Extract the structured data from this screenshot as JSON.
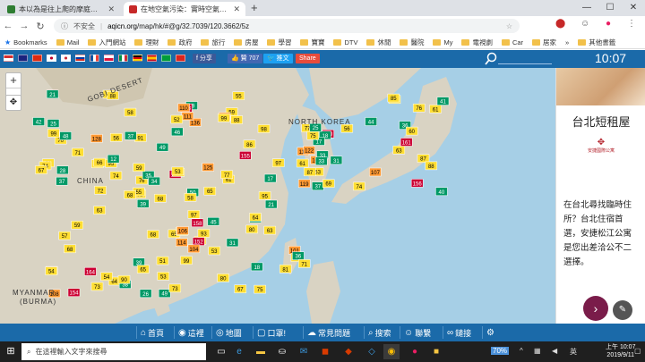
{
  "browser": {
    "tabs": [
      {
        "title": "本以為是往上爬的摩庭，卻走向",
        "favicon_color": "#2e7d32",
        "active": false
      },
      {
        "title": "在地空氣污染：實時空氣質量指數",
        "favicon_color": "#c62828",
        "active": true
      }
    ],
    "new_tab": "+",
    "window": {
      "minimize": "—",
      "maximize": "☐",
      "close": "✕"
    },
    "nav": {
      "back": "←",
      "forward": "→",
      "reload": "C"
    },
    "address": {
      "security": "不安全",
      "host": "aqicn.org",
      "path": "/map/hk/#@g/32.7039/120.3662/5z"
    },
    "bookmarks": [
      {
        "label": "Bookmarks",
        "type": "star"
      },
      {
        "label": "Mail",
        "type": "folder"
      },
      {
        "label": "入門網站",
        "type": "folder"
      },
      {
        "label": "理財",
        "type": "folder"
      },
      {
        "label": "政府",
        "type": "folder"
      },
      {
        "label": "旅行",
        "type": "folder"
      },
      {
        "label": "房屋",
        "type": "folder"
      },
      {
        "label": "學習",
        "type": "folder"
      },
      {
        "label": "寶寶",
        "type": "folder"
      },
      {
        "label": "DTV",
        "type": "folder"
      },
      {
        "label": "休閒",
        "type": "folder"
      },
      {
        "label": "醫院",
        "type": "folder"
      },
      {
        "label": "My",
        "type": "folder"
      },
      {
        "label": "電視劇",
        "type": "folder"
      },
      {
        "label": "Car",
        "type": "folder"
      },
      {
        "label": "居家",
        "type": "folder"
      },
      {
        "label": "»",
        "type": "more"
      },
      {
        "label": "其他書籤",
        "type": "folder"
      }
    ]
  },
  "site": {
    "share": {
      "fb_share": "f 分享",
      "like": "👍 贊 707",
      "tweet": "🐦 推文",
      "share": "Share"
    },
    "clock": "10:07",
    "map_labels": {
      "china": "CHINA",
      "north_korea": "NORTH KOREA",
      "myanmar": "MYANMAR",
      "burma": "(BURMA)",
      "gobi": "GOBI DESERT"
    },
    "zoom": {
      "in": "+",
      "out": "−"
    },
    "footer": [
      {
        "icon": "home-icon",
        "glyph": "⌂",
        "label": "首頁"
      },
      {
        "icon": "eye-icon",
        "glyph": "◉",
        "label": "這裡"
      },
      {
        "icon": "globe-icon",
        "glyph": "◎",
        "label": "地圖"
      },
      {
        "icon": "mask-icon",
        "glyph": "▢",
        "label": "口罩!"
      },
      {
        "icon": "faq-icon",
        "glyph": "☁",
        "label": "常見問題"
      },
      {
        "icon": "search-icon",
        "glyph": "⌕",
        "label": "搜索"
      },
      {
        "icon": "contact-icon",
        "glyph": "☺",
        "label": "聯繫"
      },
      {
        "icon": "link-icon",
        "glyph": "∞",
        "label": "鏈接"
      },
      {
        "icon": "settings-icon",
        "glyph": "⚙",
        "label": ""
      }
    ]
  },
  "ad": {
    "title": "台北短租屋",
    "logo_text": "安捷國際公寓",
    "body": "在台北尋找臨時住所？台北住宿首選，安捷松江公寓是您出差洽公不二選擇。",
    "next": "›"
  },
  "taskbar": {
    "search_placeholder": "在這裡輸入文字來搜尋",
    "battery": "70%",
    "ime": "英",
    "time": "上午 10:07",
    "date": "2019/9/11"
  },
  "colors": {
    "site_blue": "#1b6aa9",
    "good": "#009966",
    "moderate": "#ffde33",
    "sensitive": "#ff9933",
    "unhealthy": "#cc0033",
    "very_unhealthy": "#660099"
  },
  "markers": [
    {
      "v": "63",
      "c": "moderate"
    },
    {
      "v": "70",
      "c": "moderate"
    },
    {
      "v": "92",
      "c": "moderate"
    },
    {
      "v": "112",
      "c": "sensitive"
    },
    {
      "v": "151",
      "c": "unhealthy"
    },
    {
      "v": "84",
      "c": "moderate"
    },
    {
      "v": "49",
      "c": "good"
    },
    {
      "v": "57",
      "c": "moderate"
    },
    {
      "v": "136",
      "c": "sensitive"
    },
    {
      "v": "161",
      "c": "unhealthy"
    },
    {
      "v": "111",
      "c": "sensitive"
    },
    {
      "v": "75",
      "c": "moderate"
    },
    {
      "v": "37",
      "c": "good"
    },
    {
      "v": "98",
      "c": "moderate"
    },
    {
      "v": "102",
      "c": "sensitive"
    },
    {
      "v": "155",
      "c": "unhealthy"
    },
    {
      "v": "154",
      "c": "unhealthy"
    },
    {
      "v": "91",
      "c": "moderate"
    },
    {
      "v": "36",
      "c": "good"
    },
    {
      "v": "68",
      "c": "moderate"
    },
    {
      "v": "125",
      "c": "sensitive"
    },
    {
      "v": "119",
      "c": "sensitive"
    },
    {
      "v": "164",
      "c": "unhealthy"
    },
    {
      "v": "101",
      "c": "sensitive"
    },
    {
      "v": "82",
      "c": "moderate"
    },
    {
      "v": "25",
      "c": "good"
    },
    {
      "v": "48",
      "c": "good"
    },
    {
      "v": "62",
      "c": "moderate"
    },
    {
      "v": "117",
      "c": "sensitive"
    },
    {
      "v": "158",
      "c": "unhealthy"
    },
    {
      "v": "97",
      "c": "moderate"
    },
    {
      "v": "55",
      "c": "moderate"
    },
    {
      "v": "39",
      "c": "good"
    },
    {
      "v": "76",
      "c": "moderate"
    },
    {
      "v": "128",
      "c": "sensitive"
    },
    {
      "v": "160",
      "c": "unhealthy"
    },
    {
      "v": "107",
      "c": "sensitive"
    },
    {
      "v": "67",
      "c": "moderate"
    },
    {
      "v": "18",
      "c": "good"
    },
    {
      "v": "45",
      "c": "good"
    },
    {
      "v": "59",
      "c": "moderate"
    },
    {
      "v": "95",
      "c": "moderate"
    },
    {
      "v": "122",
      "c": "sensitive"
    },
    {
      "v": "152",
      "c": "unhealthy"
    },
    {
      "v": "73",
      "c": "moderate"
    },
    {
      "v": "56",
      "c": "moderate"
    },
    {
      "v": "79",
      "c": "moderate"
    },
    {
      "v": "108",
      "c": "sensitive"
    },
    {
      "v": "65",
      "c": "moderate"
    },
    {
      "v": "33",
      "c": "good"
    },
    {
      "v": "114",
      "c": "sensitive"
    },
    {
      "v": "86",
      "c": "moderate"
    },
    {
      "v": "42",
      "c": "good"
    },
    {
      "v": "93",
      "c": "moderate"
    },
    {
      "v": "156",
      "c": "unhealthy"
    },
    {
      "v": "104",
      "c": "sensitive"
    },
    {
      "v": "77",
      "c": "moderate"
    },
    {
      "v": "21",
      "c": "good"
    },
    {
      "v": "51",
      "c": "moderate"
    },
    {
      "v": "88",
      "c": "moderate"
    },
    {
      "v": "131",
      "c": "sensitive"
    },
    {
      "v": "72",
      "c": "moderate"
    },
    {
      "v": "61",
      "c": "moderate"
    },
    {
      "v": "44",
      "c": "good"
    },
    {
      "v": "99",
      "c": "moderate"
    },
    {
      "v": "153",
      "c": "unhealthy"
    },
    {
      "v": "110",
      "c": "sensitive"
    },
    {
      "v": "58",
      "c": "moderate"
    },
    {
      "v": "35",
      "c": "good"
    },
    {
      "v": "81",
      "c": "moderate"
    },
    {
      "v": "53",
      "c": "moderate"
    },
    {
      "v": "64",
      "c": "moderate"
    },
    {
      "v": "87",
      "c": "moderate"
    },
    {
      "v": "69",
      "c": "moderate"
    },
    {
      "v": "54",
      "c": "moderate"
    },
    {
      "v": "52",
      "c": "moderate"
    },
    {
      "v": "71",
      "c": "moderate"
    },
    {
      "v": "61",
      "c": "moderate"
    },
    {
      "v": "59",
      "c": "moderate"
    },
    {
      "v": "53",
      "c": "moderate"
    },
    {
      "v": "61",
      "c": "moderate"
    },
    {
      "v": "74",
      "c": "moderate"
    },
    {
      "v": "50",
      "c": "good"
    },
    {
      "v": "80",
      "c": "moderate"
    },
    {
      "v": "37",
      "c": "good"
    },
    {
      "v": "17",
      "c": "good"
    },
    {
      "v": "68",
      "c": "moderate"
    },
    {
      "v": "80",
      "c": "moderate"
    },
    {
      "v": "49",
      "c": "good"
    },
    {
      "v": "99",
      "c": "moderate"
    },
    {
      "v": "85",
      "c": "moderate"
    },
    {
      "v": "31",
      "c": "good"
    },
    {
      "v": "36",
      "c": "good"
    },
    {
      "v": "53",
      "c": "moderate"
    },
    {
      "v": "34",
      "c": "good"
    },
    {
      "v": "63",
      "c": "moderate"
    },
    {
      "v": "74",
      "c": "moderate"
    },
    {
      "v": "26",
      "c": "good"
    },
    {
      "v": "18",
      "c": "good"
    },
    {
      "v": "76",
      "c": "moderate"
    },
    {
      "v": "58",
      "c": "moderate"
    },
    {
      "v": "52",
      "c": "moderate"
    },
    {
      "v": "95",
      "c": "moderate"
    },
    {
      "v": "67",
      "c": "moderate"
    },
    {
      "v": "59",
      "c": "moderate"
    },
    {
      "v": "87",
      "c": "moderate"
    },
    {
      "v": "54",
      "c": "moderate"
    },
    {
      "v": "53",
      "c": "moderate"
    },
    {
      "v": "61",
      "c": "moderate"
    },
    {
      "v": "74",
      "c": "moderate"
    },
    {
      "v": "21",
      "c": "good"
    },
    {
      "v": "25",
      "c": "good"
    },
    {
      "v": "17",
      "c": "good"
    },
    {
      "v": "68",
      "c": "moderate"
    },
    {
      "v": "88",
      "c": "moderate"
    },
    {
      "v": "65",
      "c": "moderate"
    },
    {
      "v": "39",
      "c": "good"
    },
    {
      "v": "41",
      "c": "good"
    },
    {
      "v": "37",
      "c": "good"
    },
    {
      "v": "25",
      "c": "good"
    },
    {
      "v": "51",
      "c": "moderate"
    },
    {
      "v": "55",
      "c": "moderate"
    },
    {
      "v": "49",
      "c": "good"
    },
    {
      "v": "56",
      "c": "moderate"
    },
    {
      "v": "65",
      "c": "moderate"
    },
    {
      "v": "97",
      "c": "moderate"
    },
    {
      "v": "40",
      "c": "good"
    },
    {
      "v": "38",
      "c": "good"
    },
    {
      "v": "77",
      "c": "moderate"
    },
    {
      "v": "99",
      "c": "moderate"
    },
    {
      "v": "106",
      "c": "sensitive"
    },
    {
      "v": "73",
      "c": "moderate"
    },
    {
      "v": "66",
      "c": "moderate"
    },
    {
      "v": "75",
      "c": "moderate"
    },
    {
      "v": "64",
      "c": "moderate"
    },
    {
      "v": "88",
      "c": "moderate"
    },
    {
      "v": "63",
      "c": "moderate"
    },
    {
      "v": "57",
      "c": "moderate"
    },
    {
      "v": "71",
      "c": "moderate"
    },
    {
      "v": "12",
      "c": "good"
    },
    {
      "v": "33",
      "c": "good"
    },
    {
      "v": "28",
      "c": "good"
    },
    {
      "v": "31",
      "c": "good"
    },
    {
      "v": "68",
      "c": "moderate"
    },
    {
      "v": "60",
      "c": "moderate"
    },
    {
      "v": "46",
      "c": "good"
    },
    {
      "v": "90",
      "c": "moderate"
    },
    {
      "v": "69",
      "c": "moderate"
    }
  ]
}
